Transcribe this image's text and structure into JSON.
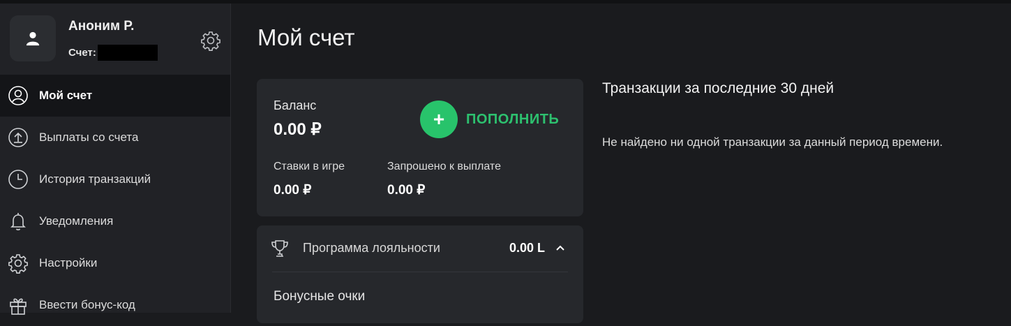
{
  "profile": {
    "name": "Аноним Р.",
    "account_label": "Счет:"
  },
  "sidebar": {
    "items": [
      {
        "label": "Мой счет",
        "icon": "user-circle-icon",
        "active": true
      },
      {
        "label": "Выплаты со счета",
        "icon": "upload-circle-icon"
      },
      {
        "label": "История транзакций",
        "icon": "clock-icon"
      },
      {
        "label": "Уведомления",
        "icon": "bell-icon"
      },
      {
        "label": "Настройки",
        "icon": "gear-icon"
      },
      {
        "label": "Ввести бонус-код",
        "icon": "gift-icon"
      }
    ]
  },
  "main": {
    "title": "Мой счет",
    "balance": {
      "label": "Баланс",
      "value": "0.00 ₽",
      "topup_label": "ПОПОЛНИТЬ",
      "bets_label": "Ставки в игре",
      "bets_value": "0.00 ₽",
      "withdraw_label": "Запрошено к выплате",
      "withdraw_value": "0.00 ₽"
    },
    "loyalty": {
      "title": "Программа лояльности",
      "value": "0.00 L",
      "bonus_label": "Бонусные очки"
    },
    "transactions": {
      "title": "Транзакции за последние 30 дней",
      "empty": "Не найдено ни одной транзакции за данный период времени."
    }
  },
  "colors": {
    "accent_green": "#28c36b",
    "background": "#1a1b1e",
    "panel": "#26282c",
    "sidebar": "#212226"
  }
}
